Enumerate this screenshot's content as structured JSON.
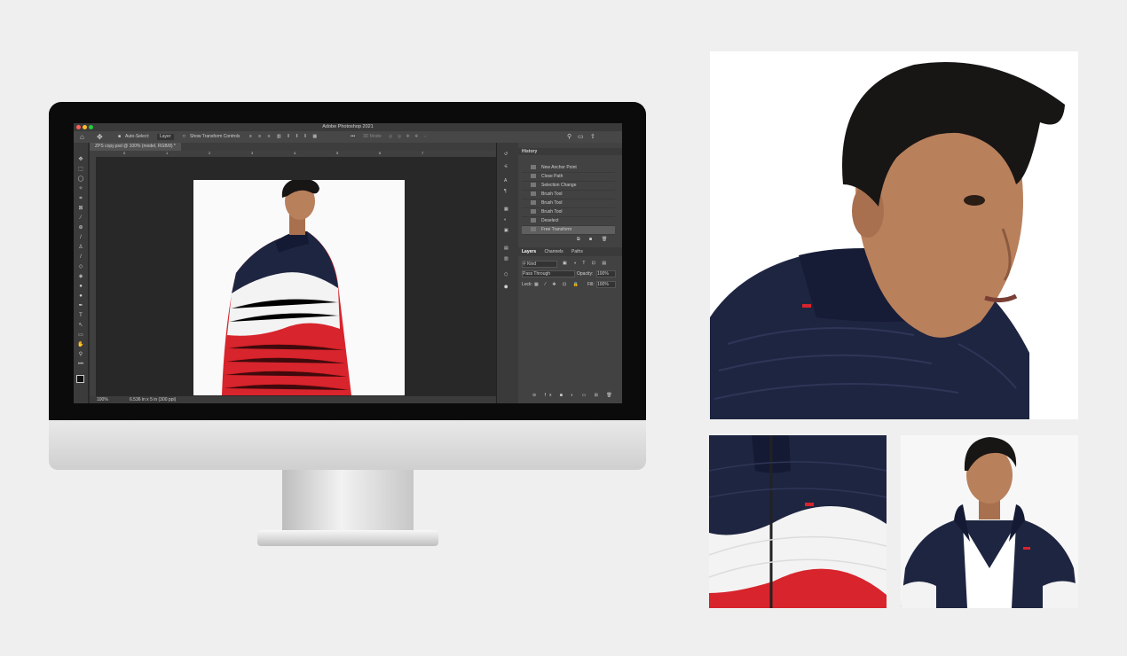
{
  "window": {
    "title": "Adobe Photoshop 2021"
  },
  "options_bar": {
    "auto_select_label": "Auto-Select:",
    "auto_select_value": "Layer",
    "transform_label": "Show Transform Controls",
    "mode_3d": "3D Mode:"
  },
  "document": {
    "tab_title": "ZPS copy.psd @ 100% (model, RGB/8) *"
  },
  "ruler_ticks": [
    "0",
    "1",
    "2",
    "3",
    "4",
    "5",
    "6",
    "7"
  ],
  "status": {
    "zoom": "100%",
    "size": "6.536 in x 5 in (300 ppi)"
  },
  "history": {
    "title": "History",
    "items": [
      "New Anchor Point",
      "Close Path",
      "Selection Change",
      "Brush Tool",
      "Brush Tool",
      "Brush Tool",
      "Deselect",
      "Free Transform"
    ],
    "selected_index": 7
  },
  "layers": {
    "tabs": [
      "Layers",
      "Channels",
      "Paths"
    ],
    "filter_label": "Kind",
    "blend_mode": "Pass Through",
    "opacity_label": "Opacity:",
    "opacity_value": "100%",
    "lock_label": "Lock:",
    "fill_label": "Fill:",
    "fill_value": "100%"
  },
  "colors": {
    "background": "#efefef",
    "jacket_navy": "#1e2541",
    "jacket_white": "#f3f3f3",
    "jacket_red": "#d8242c",
    "hair": "#181515",
    "skin": "#b9805c"
  }
}
